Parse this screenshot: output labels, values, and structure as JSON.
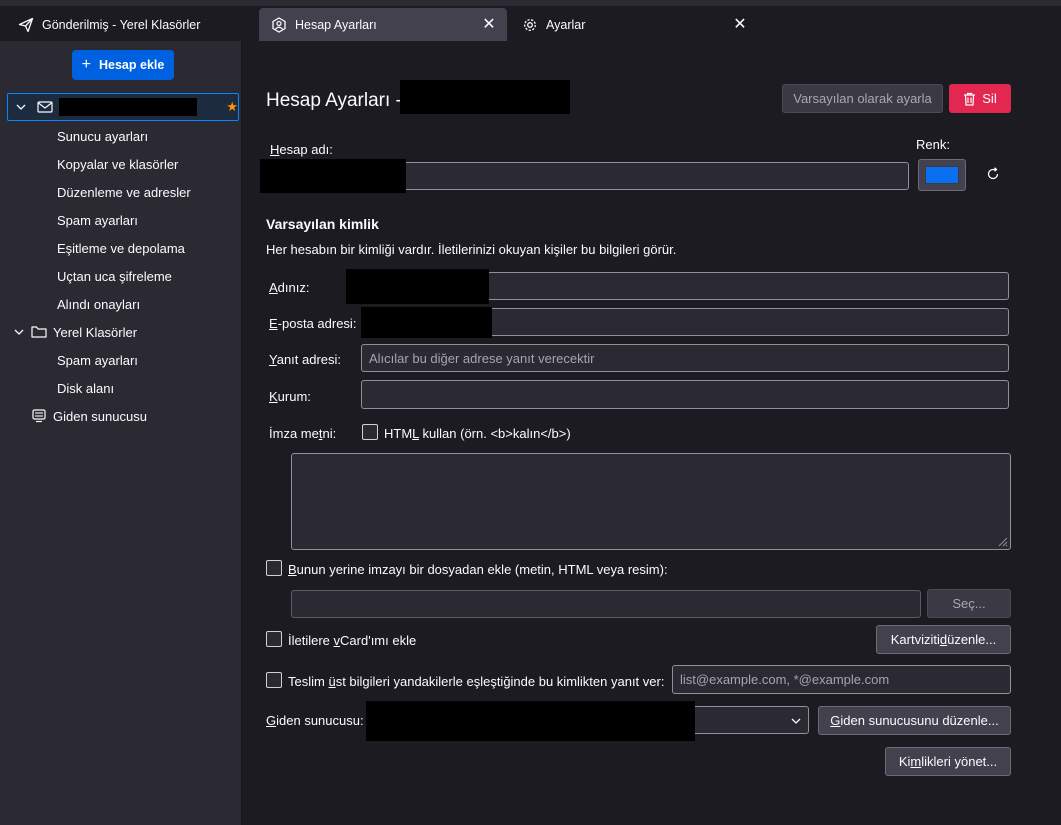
{
  "tabs": [
    {
      "label": "Gönderilmiş - Yerel Klasörler",
      "icon": "send-icon"
    },
    {
      "label": "Hesap Ayarları",
      "icon": "account-settings-icon",
      "active": true
    },
    {
      "label": "Ayarlar",
      "icon": "gear-icon"
    }
  ],
  "sidebar": {
    "add_account": "Hesap ekle",
    "account_items": [
      "Sunucu ayarları",
      "Kopyalar ve klasörler",
      "Düzenleme ve adresler",
      "Spam ayarları",
      "Eşitleme ve depolama",
      "Uçtan uca şifreleme",
      "Alındı onayları"
    ],
    "local_folders": "Yerel Klasörler",
    "local_items": [
      "Spam ayarları",
      "Disk alanı"
    ],
    "outgoing": "Giden sunucusu"
  },
  "main": {
    "title": "Hesap Ayarları -",
    "set_default": "Varsayılan olarak ayarla",
    "delete": "Sil",
    "account_name_label": "Hesap adı:",
    "color_label": "Renk:",
    "color_value": "#0a6ff0",
    "identity_heading": "Varsayılan kimlik",
    "identity_desc": "Her hesabın bir kimliği vardır. İletilerinizi okuyan kişiler bu bilgileri görür.",
    "name_label": "Adınız:",
    "email_label": "E-posta adresi:",
    "reply_label": "Yanıt adresi:",
    "reply_placeholder": "Alıcılar bu diğer adrese yanıt verecektir",
    "org_label": "Kurum:",
    "sig_label": "İmza metni:",
    "html_label": "HTML kullan (örn. <b>kalın</b>)",
    "sig_file_label": "Bunun yerine imzayı bir dosyadan ekle (metin, HTML veya resim):",
    "choose": "Seç...",
    "vcard_label": "İletilere vCard'ımı ekle",
    "edit_card": "Kartviziti düzenle...",
    "reply_from_label": "Teslim üst bilgileri yandakilerle eşleştiğinde bu kimlikten yanıt ver:",
    "reply_from_placeholder": "list@example.com, *@example.com",
    "smtp_label": "Giden sunucusu:",
    "edit_smtp": "Giden sunucusunu düzenle...",
    "manage_identities": "Kimlikleri yönet..."
  }
}
